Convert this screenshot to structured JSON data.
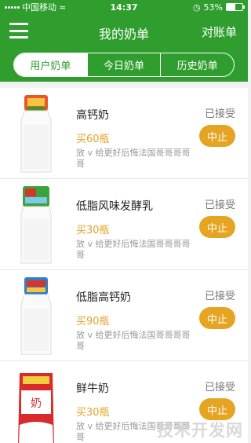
{
  "status_bar": {
    "carrier": "中国移动",
    "time": "14:37",
    "battery_percent": "53%",
    "battery_level": 0.53
  },
  "navbar": {
    "title": "我的奶单",
    "right_action": "对账单"
  },
  "tabs": [
    {
      "label": "用户奶单",
      "active": true
    },
    {
      "label": "今日奶单",
      "active": false
    },
    {
      "label": "历史奶单",
      "active": false
    }
  ],
  "items": [
    {
      "name": "高钙奶",
      "quantity": "买60瓶",
      "description": "放 v 给更好后悔法国哥哥哥哥哥",
      "status": "已接受",
      "action": "中止",
      "icon": "milk-bottle-icon"
    },
    {
      "name": "低脂风味发酵乳",
      "quantity": "买30瓶",
      "description": "放 v 给更好后悔法国哥哥哥哥哥",
      "status": "已接受",
      "action": "中止",
      "icon": "yogurt-bottle-icon"
    },
    {
      "name": "低脂高钙奶",
      "quantity": "买90瓶",
      "description": "放 v 给更好后悔法国哥哥哥哥哥",
      "status": "已接受",
      "action": "中止",
      "icon": "milk-bottle-icon"
    },
    {
      "name": "鲜牛奶",
      "quantity": "买30瓶",
      "description": "放 v 给更好后悔法国哥哥哥哥哥",
      "status": "已接受",
      "action": "中止",
      "icon": "milk-carton-icon"
    }
  ],
  "watermark": "技术开发网",
  "colors": {
    "brand_green": "#2f9e2f",
    "accent_orange": "#e5a522"
  }
}
